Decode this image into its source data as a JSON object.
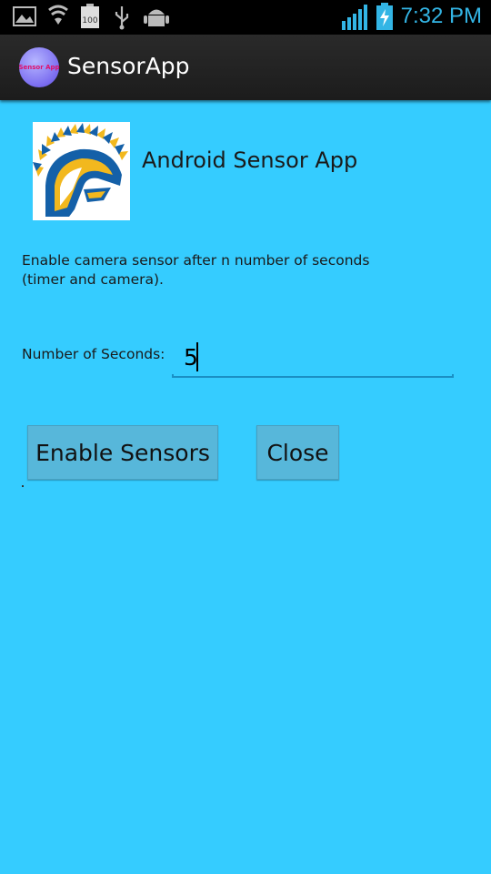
{
  "status_bar": {
    "time": "7:32 PM",
    "battery_level": "100",
    "icons": [
      "gallery-icon",
      "lg-shield-icon",
      "battery-100-icon",
      "usb-icon",
      "android-debug-icon",
      "signal-icon",
      "battery-charging-icon"
    ]
  },
  "action_bar": {
    "app_icon_text": "Sensor App",
    "title": "SensorApp"
  },
  "main": {
    "header_title": "Android Sensor App",
    "description": "Enable camera sensor after n number of seconds (timer and camera).",
    "seconds_label": "Number of Seconds:",
    "seconds_value": "5",
    "enable_button": "Enable Sensors",
    "close_button": "Close"
  },
  "colors": {
    "background": "#35ccff",
    "button": "#57b7da",
    "accent": "#33b5e5"
  }
}
